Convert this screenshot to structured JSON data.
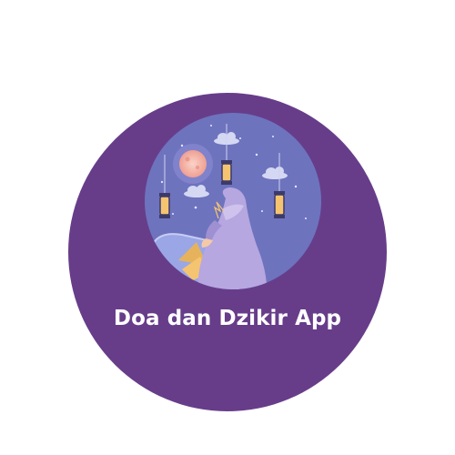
{
  "logo": {
    "app_name": "Doa dan Dzikir App",
    "icon": "praying-woman-night-sky-illustration",
    "colors": {
      "circle_background": "#673d8a",
      "sky": "#6e73be",
      "moon": "#f3b6a8",
      "figure": "#b6a7e0",
      "lantern": "#f5c470",
      "text": "#ffffff"
    }
  }
}
